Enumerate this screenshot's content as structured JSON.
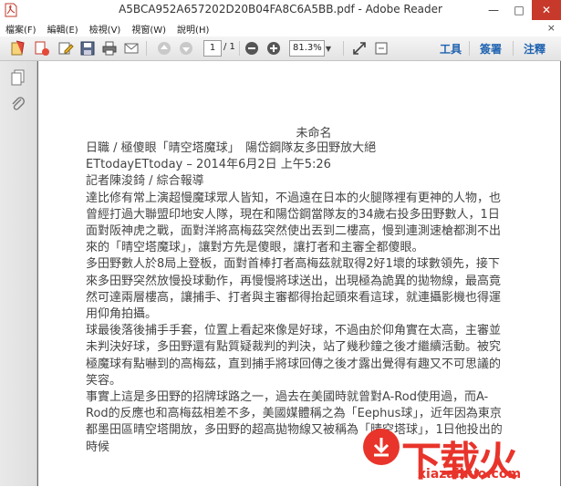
{
  "window": {
    "title": "A5BCA952A657202D20B04FA8C6A5BB.pdf - Adobe Reader",
    "minimize": "—",
    "maximize": "□",
    "close": "✕"
  },
  "menu": {
    "items": [
      "檔案(F)",
      "編輯(E)",
      "檢視(V)",
      "視窗(W)",
      "說明(H)"
    ],
    "close": "×"
  },
  "toolbar": {
    "page_current": "1",
    "page_total": "/ 1",
    "zoom": "81.3%",
    "tools_label": "工具",
    "sign_label": "簽署",
    "comment_label": "注釋"
  },
  "document": {
    "title": "未命名",
    "lines": [
      "日職 / 極傻眼「晴空塔魔球」　陽岱鋼隊友多田野放大絕",
      "ETtodayETtoday – 2014年6月2日 上午5:26",
      "記者陳浚錡 / 綜合報導"
    ],
    "paragraphs": [
      "達比修有常上演超慢魔球眾人皆知，不過遠在日本的火腿隊裡有更神的人物，也曾經打過大聯盟印地安人隊，現在和陽岱鋼當隊友的34歲右投多田野數人，1日面對阪神虎之戰，面對洋將高梅茲突然使出丟到二樓高，慢到連測速槍都測不出來的「晴空塔魔球」，讓對方先是傻眼，讓打者和主審全都傻眼。",
      "多田野數人於8局上登板，面對首棒打者高梅茲就取得2好1壞的球數領先，接下來多田野突然放慢投球動作，再慢慢將球送出，出現極為詭異的拋物線，最高竟然可達兩層樓高，讓捕手、打者與主審都得抬起頭來看這球，就連攝影機也得運用仰角拍攝。",
      "球最後落後捕手手套，位置上看起來像是好球，不過由於仰角實在太高，主審並未判決好球，多田野還有點質疑裁判的判決，站了幾秒鐘之後才繼續活動。被究極魔球有點嚇到的高梅茲，直到捕手將球回傳之後才露出覺得有趣又不可思議的笑容。",
      "事實上這是多田野的招牌球路之一，過去在美國時就曾對A-Rod使用過，而A-Rod的反應也和高梅茲相差不多，美國媒體稱之為「Eephus球」，近年因為東京都墨田區晴空塔開放，多田野的超高拋物線又被稱為「晴空塔球」，1日他投出的時候"
    ]
  },
  "watermark": {
    "logo": "下载火",
    "url": "xiazaihuo.com"
  },
  "colors": {
    "accent": "#1e62b0",
    "close_button": "#c7392b",
    "watermark_red": "#e8342b"
  }
}
